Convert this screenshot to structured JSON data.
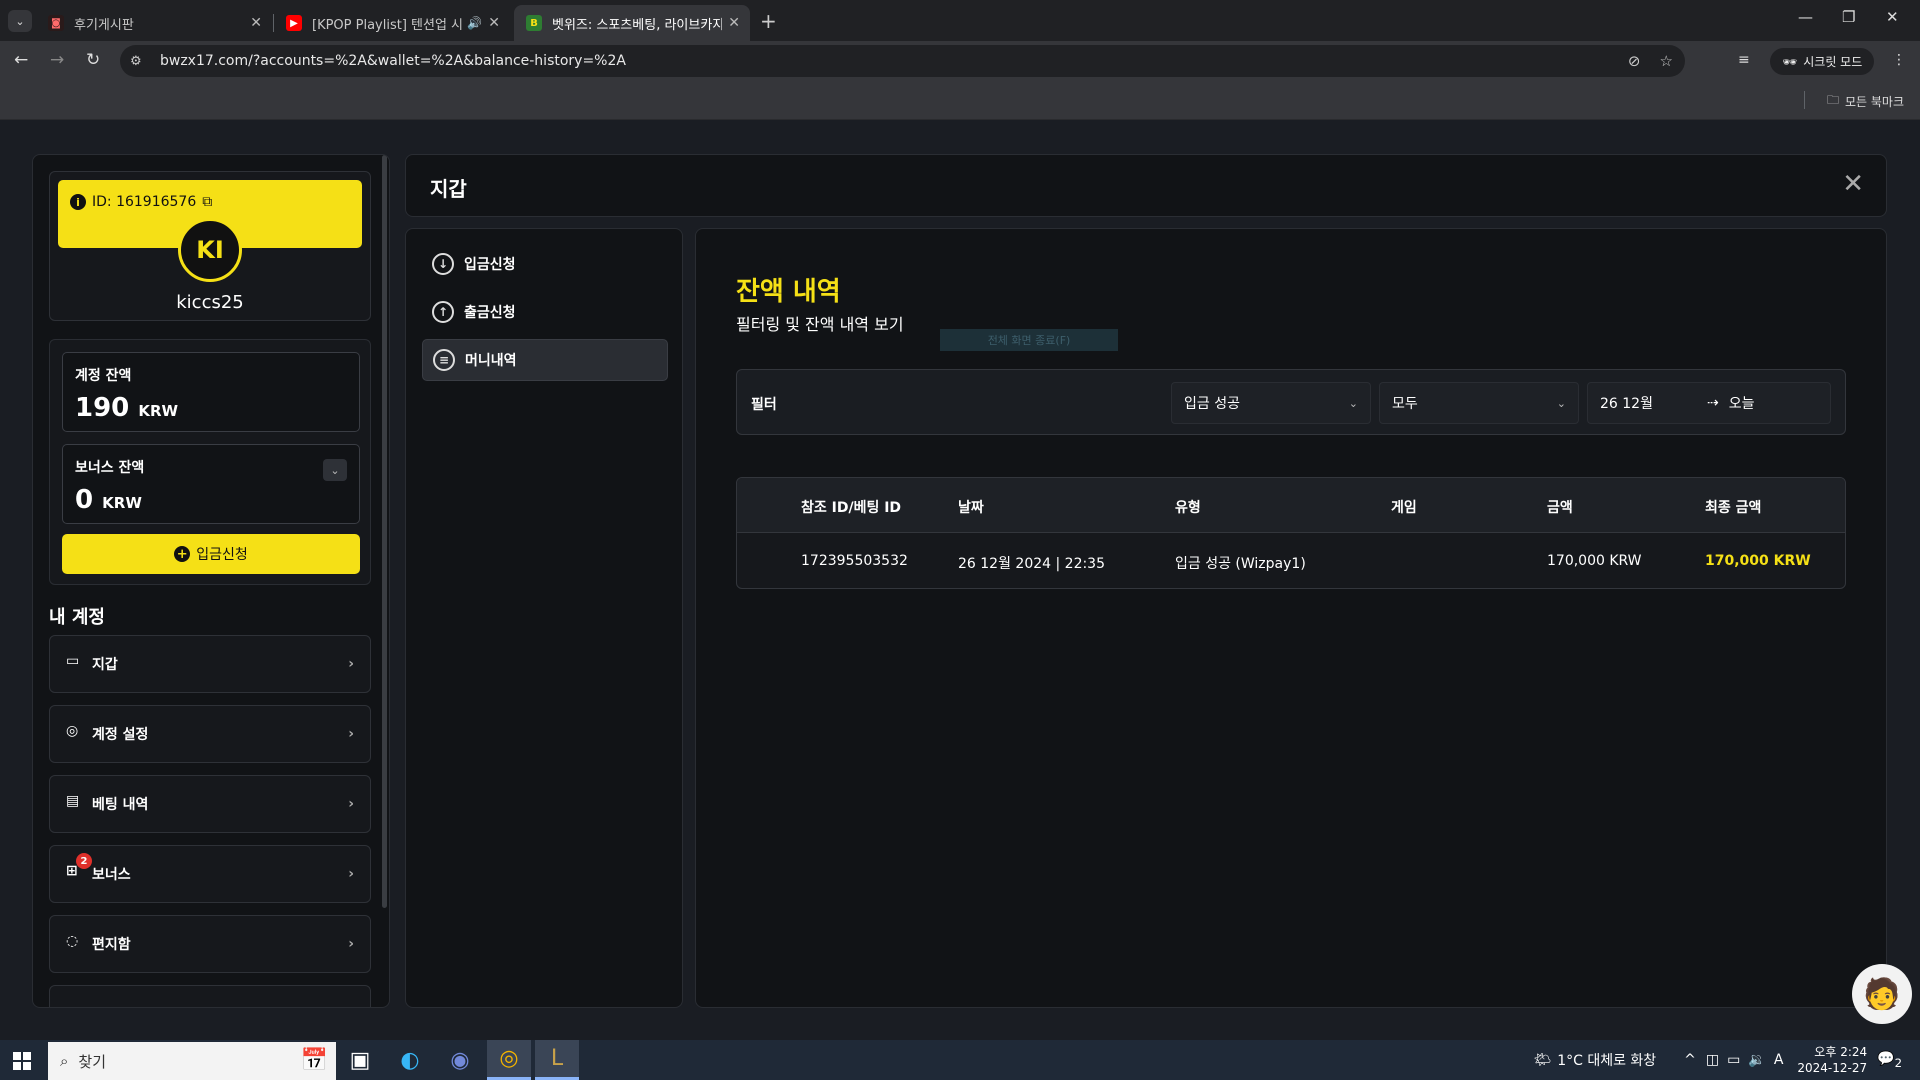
{
  "browser": {
    "tabs": [
      {
        "title": "후기게시판",
        "active": false
      },
      {
        "title": "[KPOP Playlist] 텐션업 시키",
        "active": false
      },
      {
        "title": "벳위즈: 스포츠베팅, 라이브카지",
        "active": true
      }
    ],
    "url": "bwzx17.com/?accounts=%2A&wallet=%2A&balance-history=%2A",
    "incognito_label": "시크릿 모드",
    "bookmarks_label": "모든 북마크"
  },
  "sidebar": {
    "id_label": "ID: 161916576",
    "avatar_initials": "KI",
    "username": "kiccs25",
    "account_balance": {
      "label": "계정 잔액",
      "amount": "190",
      "currency": "KRW"
    },
    "bonus_balance": {
      "label": "보너스 잔액",
      "amount": "0",
      "currency": "KRW"
    },
    "deposit_button": "입금신청",
    "my_account_heading": "내 계정",
    "menu": [
      {
        "label": "지갑",
        "icon": "wallet-icon"
      },
      {
        "label": "계정 설정",
        "icon": "user-icon"
      },
      {
        "label": "베팅 내역",
        "icon": "receipt-icon"
      },
      {
        "label": "보너스",
        "icon": "gift-icon",
        "badge": "2"
      },
      {
        "label": "편지함",
        "icon": "chat-icon"
      }
    ]
  },
  "wallet": {
    "title": "지갑",
    "submenu": [
      {
        "label": "입금신청",
        "icon": "download-icon"
      },
      {
        "label": "출금신청",
        "icon": "upload-icon"
      },
      {
        "label": "머니내역",
        "icon": "history-icon"
      }
    ],
    "panel_title": "잔액 내역",
    "panel_subtitle": "필터링 및 잔액 내역 보기",
    "ghost_tooltip": "전체 화면 종료(F)",
    "filter": {
      "label": "필터",
      "type_value": "입금 성공",
      "game_value": "모두",
      "date_from": "26 12월",
      "date_to": "오늘"
    },
    "table": {
      "headers": [
        "참조 ID/베팅 ID",
        "날짜",
        "유형",
        "게임",
        "금액",
        "최종 금액"
      ],
      "rows": [
        [
          "172395503532",
          "26 12월 2024 | 22:35",
          "입금 성공 (Wizpay1)",
          "",
          "170,000 KRW",
          "170,000 KRW"
        ]
      ]
    }
  },
  "taskbar": {
    "search_placeholder": "찾기",
    "weather": "1°C  대체로 화창",
    "time": "오후 2:24",
    "date": "2024-12-27",
    "ime": "A",
    "notification_count": "2"
  },
  "colors": {
    "accent": "#f5e016",
    "panel": "#111316",
    "background": "#1a1d23"
  }
}
